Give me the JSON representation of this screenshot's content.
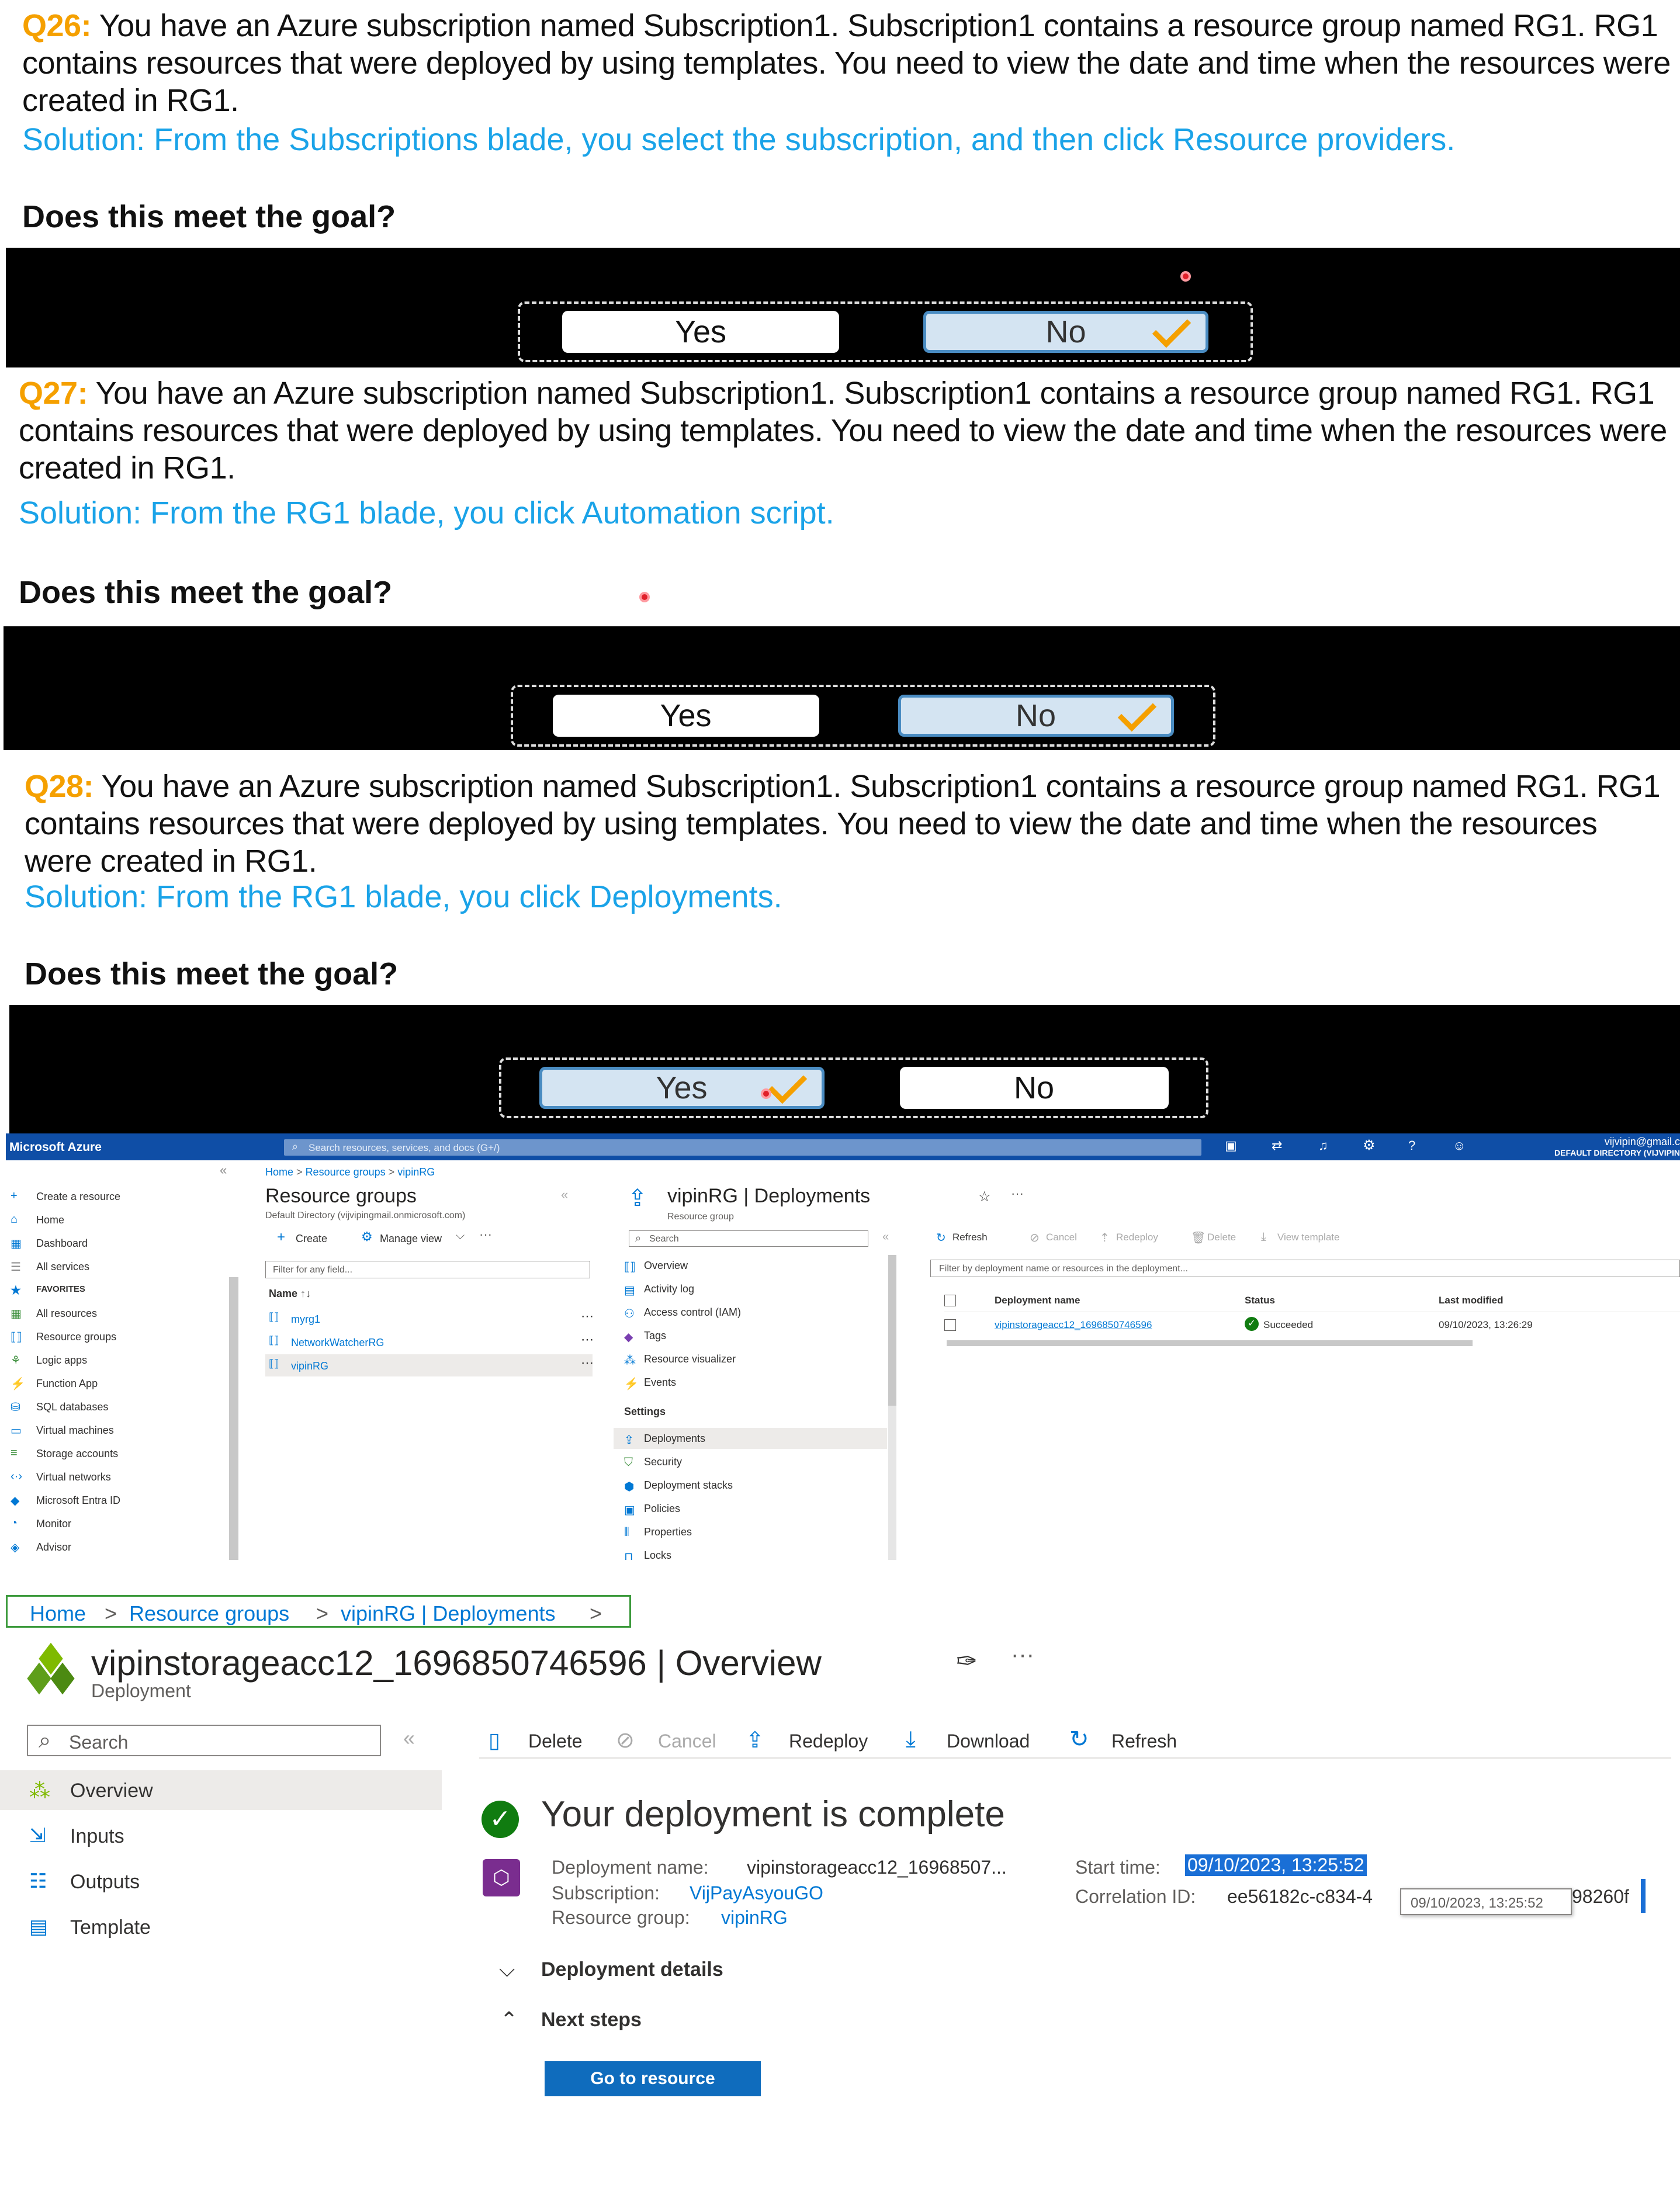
{
  "questions": [
    {
      "num": "Q26:",
      "text": " You have an Azure subscription named Subscription1. Subscription1 contains a resource group named RG1. RG1 contains resources that were deployed by using templates. You need to view the date and time when the resources were created in RG1.",
      "solution": "Solution: From the Subscriptions blade, you select the subscription, and then click Resource providers.",
      "goal": "Does this meet the goal?",
      "yes": "Yes",
      "no": "No",
      "selected": "No"
    },
    {
      "num": "Q27:",
      "text": " You have an Azure subscription named Subscription1. Subscription1 contains a resource group named RG1. RG1 contains resources that were deployed by using templates. You need to view the date and time when the resources were created in RG1.",
      "solution": "Solution: From the RG1 blade, you click Automation script.",
      "goal": "Does this meet the goal?",
      "yes": "Yes",
      "no": "No",
      "selected": "No"
    },
    {
      "num": "Q28:",
      "text": " You have an Azure subscription named Subscription1. Subscription1 contains a resource group named RG1. RG1 contains resources that were deployed by using templates. You need to view the date and time when the resources were created in RG1.",
      "solution": "Solution: From the RG1 blade, you click Deployments.",
      "goal": "Does this meet the goal?",
      "yes": "Yes",
      "no": "No",
      "selected": "Yes"
    }
  ],
  "portal": {
    "brand": "Microsoft Azure",
    "search_placeholder": "Search resources, services, and docs (G+/)",
    "user_email": "vijvipin@gmail.c",
    "user_dir": "DEFAULT DIRECTORY (VIJVIPIN",
    "left_nav": [
      "Create a resource",
      "Home",
      "Dashboard",
      "All services",
      "FAVORITES",
      "All resources",
      "Resource groups",
      "Logic apps",
      "Function App",
      "SQL databases",
      "Virtual machines",
      "Storage accounts",
      "Virtual networks",
      "Microsoft Entra ID",
      "Monitor",
      "Advisor"
    ],
    "breadcrumb": [
      "Home",
      ">",
      "Resource groups",
      ">",
      "vipinRG"
    ],
    "rg_title": "Resource groups",
    "rg_sub": "Default Directory (vijvipingmail.onmicrosoft.com)",
    "rg_create": "Create",
    "rg_manage": "Manage view",
    "rg_filter": "Filter for any field...",
    "rg_name_col": "Name ↑↓",
    "rg_items": [
      "myrg1",
      "NetworkWatcherRG",
      "vipinRG"
    ],
    "dep_title": "vipinRG | Deployments",
    "dep_sub": "Resource group",
    "dep_search": "Search",
    "dep_menu": [
      "Overview",
      "Activity log",
      "Access control (IAM)",
      "Tags",
      "Resource visualizer",
      "Events"
    ],
    "dep_settings": "Settings",
    "dep_settings_items": [
      "Deployments",
      "Security",
      "Deployment stacks",
      "Policies",
      "Properties",
      "Locks"
    ],
    "dep_toolbar": [
      "Refresh",
      "Cancel",
      "Redeploy",
      "Delete",
      "View template"
    ],
    "dep_filter": "Filter by deployment name or resources in the deployment...",
    "dep_cols": [
      "Deployment name",
      "Status",
      "Last modified"
    ],
    "dep_row": {
      "name": "vipinstorageacc12_1696850746596",
      "status": "Succeeded",
      "modified": "09/10/2023, 13:26:29"
    }
  },
  "overview": {
    "breadcrumb": [
      "Home",
      ">",
      "Resource groups",
      ">",
      "vipinRG | Deployments",
      ">"
    ],
    "title": "vipinstorageacc12_1696850746596 | Overview",
    "subtitle": "Deployment",
    "search": "Search",
    "menu": [
      "Overview",
      "Inputs",
      "Outputs",
      "Template"
    ],
    "toolbar": [
      "Delete",
      "Cancel",
      "Redeploy",
      "Download",
      "Refresh"
    ],
    "status": "Your deployment is complete",
    "labels": {
      "name": "Deployment name:",
      "subscription": "Subscription:",
      "rg": "Resource group:",
      "start": "Start time:",
      "corr": "Correlation ID:"
    },
    "values": {
      "name": "vipinstorageacc12_16968507...",
      "subscription": "VijPayAsyouGO",
      "rg": "vipinRG",
      "start": "09/10/2023, 13:25:52",
      "corr_a": "ee56182c-c834-4",
      "corr_b": "98260f",
      "tooltip": "09/10/2023, 13:25:52"
    },
    "details": "Deployment details",
    "next": "Next steps",
    "go": "Go to resource"
  }
}
